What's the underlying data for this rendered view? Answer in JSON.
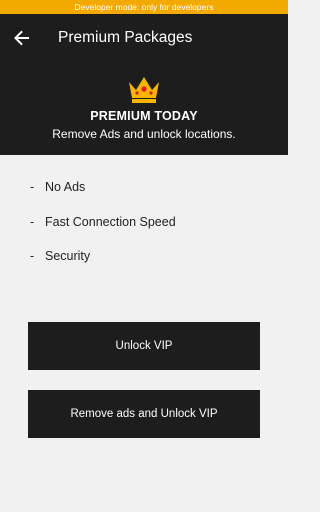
{
  "dev_banner": "Developer mode: only for developers",
  "app_bar": {
    "title": "Premium Packages",
    "back_icon": "arrow-back-icon"
  },
  "header": {
    "crown_icon": "crown-icon",
    "title": "PREMIUM TODAY",
    "subtitle": "Remove Ads and unlock locations."
  },
  "features": [
    {
      "dash": "-",
      "label": "No Ads"
    },
    {
      "dash": "-",
      "label": "Fast Connection Speed"
    },
    {
      "dash": "-",
      "label": "Security"
    }
  ],
  "buttons": {
    "unlock_vip": "Unlock VIP",
    "remove_ads_unlock_vip": "Remove ads and Unlock VIP"
  },
  "colors": {
    "banner": "#f2a900",
    "dark": "#1d1d1d",
    "background": "#f1f1f1",
    "crown": "#f7b500"
  }
}
